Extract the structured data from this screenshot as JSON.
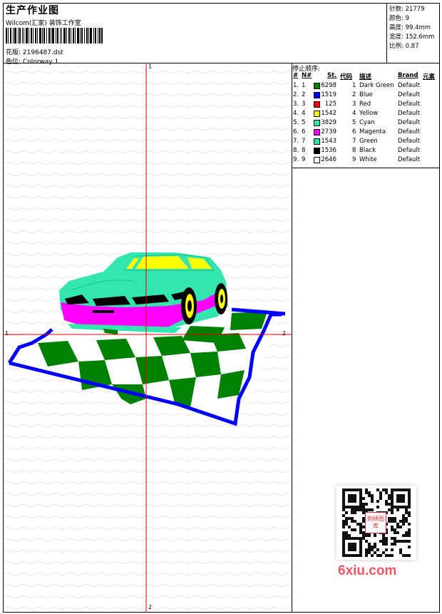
{
  "header": {
    "title": "生产作业图",
    "company": "Wilcom(汇家) 装饰工作室",
    "design_label": "花版:",
    "design_file": "2196487.dst",
    "colorway_label": "色位:",
    "colorway_value": "Colorway 1"
  },
  "stats": {
    "stitches": "针数: 21779",
    "colors": "颜色: 9",
    "height": "高度: 99.4mm",
    "width": "宽度: 152.6mm",
    "scale": "比例: 0.87"
  },
  "canvas_markers": {
    "top": "1",
    "bottom": "2",
    "left": "1",
    "right": "2"
  },
  "stop_sequence": {
    "title": "停止顺序:",
    "columns": [
      "#",
      "N#",
      "St.",
      "代码",
      "描述",
      "Brand",
      "元素"
    ],
    "rows": [
      {
        "num": "1.",
        "n": "1",
        "color": "#008000",
        "st": "6298",
        "code": "1",
        "desc": "Dark Green",
        "brand": "Default"
      },
      {
        "num": "2.",
        "n": "2",
        "color": "#0000ff",
        "st": "1519",
        "code": "2",
        "desc": "Blue",
        "brand": "Default"
      },
      {
        "num": "3.",
        "n": "3",
        "color": "#ff0000",
        "st": "125",
        "code": "3",
        "desc": "Red",
        "brand": "Default"
      },
      {
        "num": "4.",
        "n": "4",
        "color": "#ffff00",
        "st": "1542",
        "code": "4",
        "desc": "Yellow",
        "brand": "Default"
      },
      {
        "num": "5.",
        "n": "5",
        "color": "#33e6b0",
        "st": "3829",
        "code": "5",
        "desc": "Cyan",
        "brand": "Default"
      },
      {
        "num": "6.",
        "n": "6",
        "color": "#ff00ff",
        "st": "2739",
        "code": "6",
        "desc": "Magenta",
        "brand": "Default"
      },
      {
        "num": "7.",
        "n": "7",
        "color": "#22e6a6",
        "st": "1543",
        "code": "7",
        "desc": "Green",
        "brand": "Default"
      },
      {
        "num": "8.",
        "n": "8",
        "color": "#000000",
        "st": "1536",
        "code": "8",
        "desc": "Black",
        "brand": "Default"
      },
      {
        "num": "9.",
        "n": "9",
        "color": "#ffffff",
        "st": "2646",
        "code": "9",
        "desc": "White",
        "brand": "Default"
      }
    ]
  },
  "watermark": {
    "logo_text": "刺绣图库",
    "site": "6xiu.com"
  }
}
